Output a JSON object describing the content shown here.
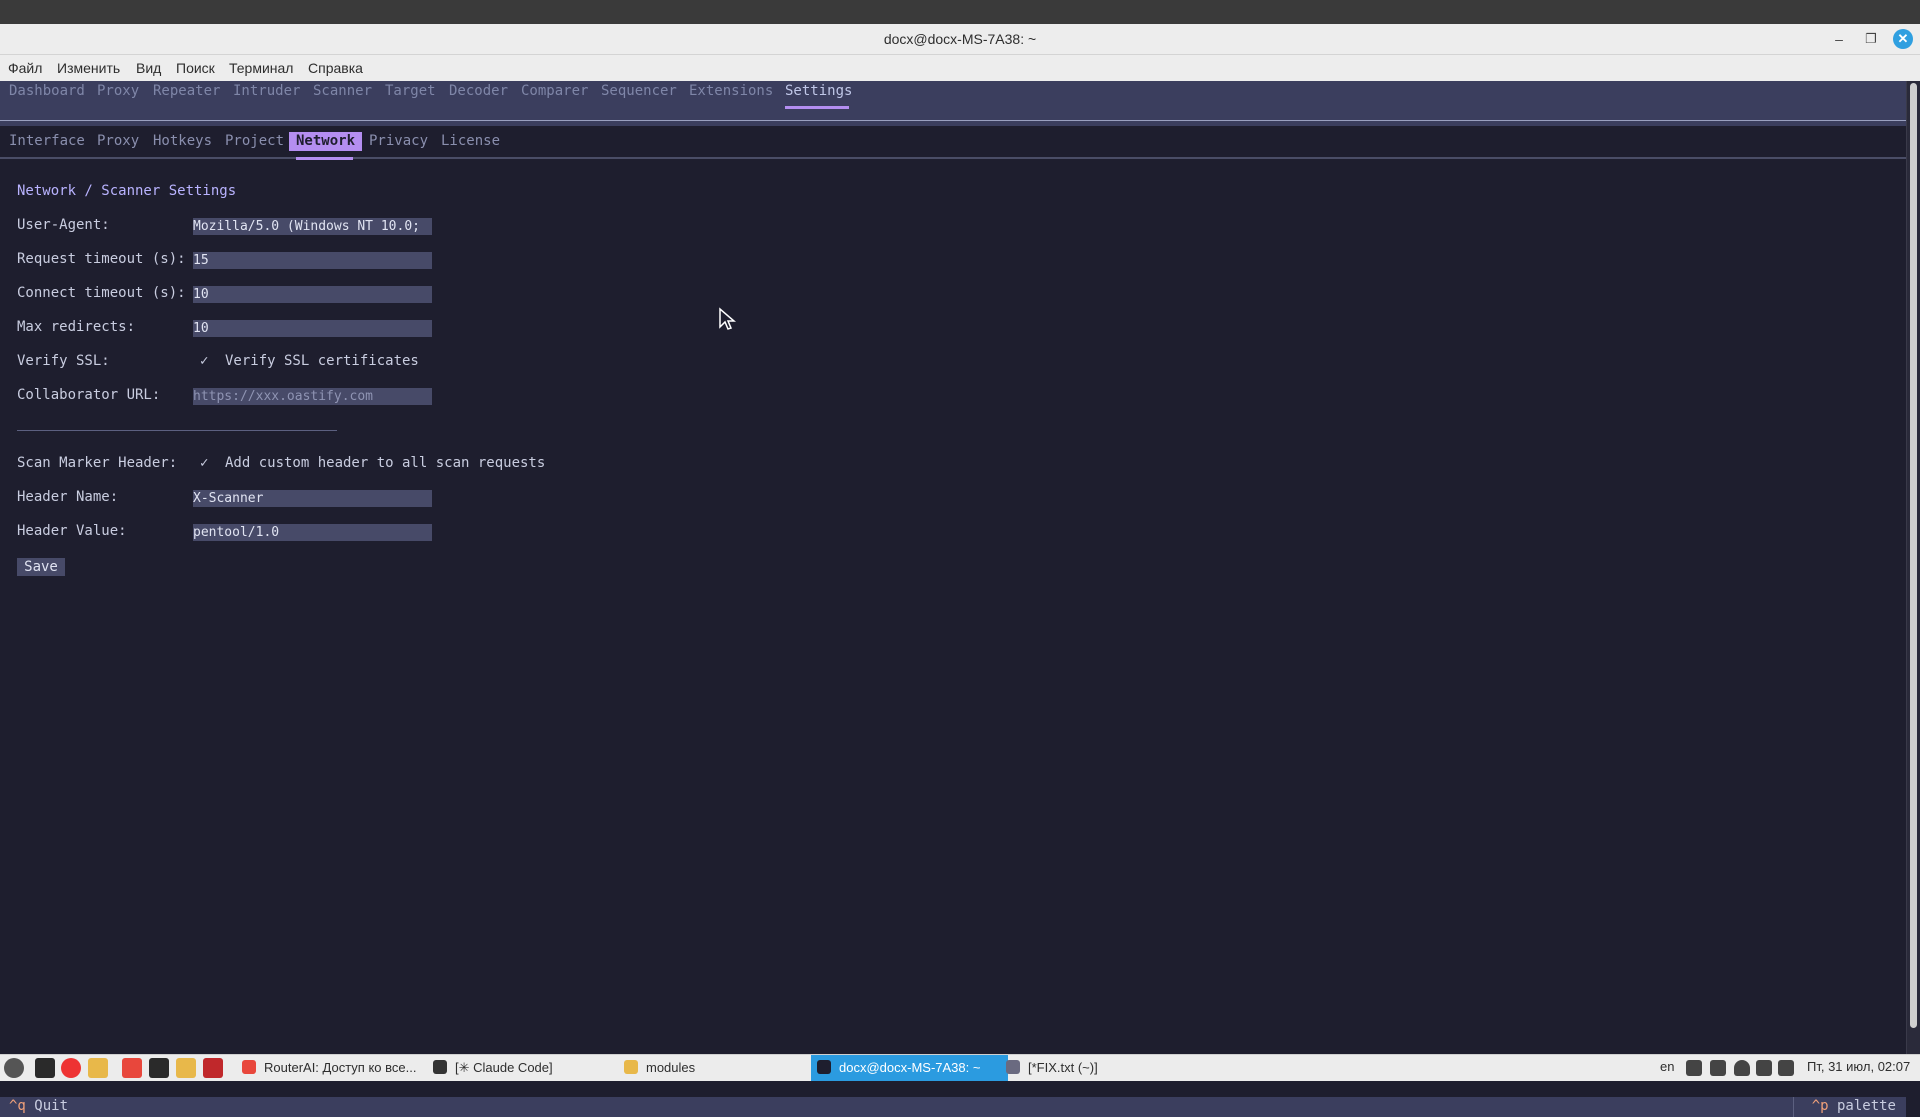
{
  "window": {
    "title": "docx@docx-MS-7A38: ~",
    "minimize": "–",
    "maximize": "❐",
    "close": "✕"
  },
  "menubar": [
    "Файл",
    "Изменить",
    "Вид",
    "Поиск",
    "Терминал",
    "Справка"
  ],
  "app": {
    "tabs": [
      "Dashboard",
      "Proxy",
      "Repeater",
      "Intruder",
      "Scanner",
      "Target",
      "Decoder",
      "Comparer",
      "Sequencer",
      "Extensions",
      "Settings"
    ],
    "active_tab": "Settings",
    "subtabs": [
      "Interface",
      "Proxy",
      "Hotkeys",
      "Project",
      "Network",
      "Privacy",
      "License"
    ],
    "active_subtab": "Network",
    "accent_color": "#b48ef0"
  },
  "settings": {
    "title": "Network / Scanner Settings",
    "user_agent_label": "User-Agent:",
    "user_agent_value": "Mozilla/5.0 (Windows NT 10.0;",
    "request_timeout_label": "Request timeout (s):",
    "request_timeout_value": "15",
    "connect_timeout_label": "Connect timeout (s):",
    "connect_timeout_value": "10",
    "max_redirects_label": "Max redirects:",
    "max_redirects_value": "10",
    "verify_ssl_label": "Verify SSL:",
    "verify_ssl_checkbox": "✓",
    "verify_ssl_text": "Verify SSL certificates",
    "collaborator_label": "Collaborator URL:",
    "collaborator_placeholder": "https://xxx.oastify.com",
    "scan_marker_label": "Scan Marker Header:",
    "scan_marker_checkbox": "✓",
    "scan_marker_text": "Add custom header to all scan requests",
    "header_name_label": "Header Name:",
    "header_name_value": "X-Scanner",
    "header_value_label": "Header Value:",
    "header_value_value": "pentool/1.0",
    "save_label": "Save"
  },
  "statusbar": {
    "quit_key": "^q",
    "quit_label": "Quit",
    "palette_key": "^p",
    "palette_label": "palette"
  },
  "taskbar": {
    "items": [
      {
        "label": "RouterAI: Доступ ко все...",
        "color": "#e8473c"
      },
      {
        "label": "[✳ Claude Code]",
        "color": "#333333"
      },
      {
        "label": "modules",
        "color": "#e8b84a"
      },
      {
        "label": "docx@docx-MS-7A38: ~",
        "color": "#1e1e2e",
        "active": true
      },
      {
        "label": "[*FIX.txt (~)]",
        "color": "#6a6a80"
      }
    ],
    "lang": "en",
    "clock": "Пт, 31 июл, 02:07"
  }
}
